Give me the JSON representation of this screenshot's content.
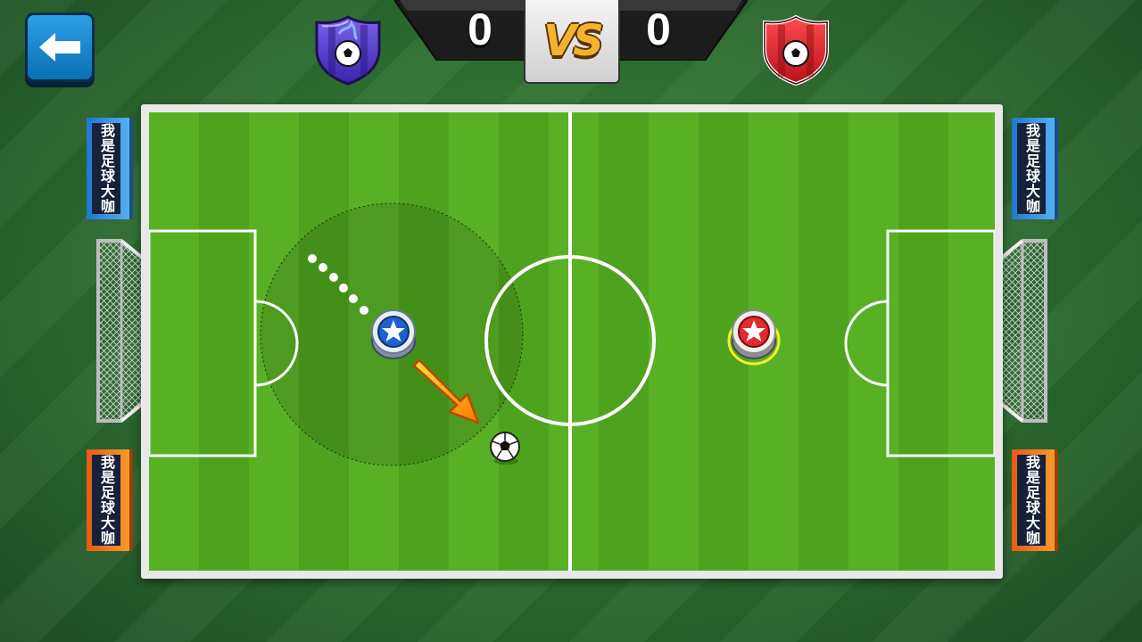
{
  "header": {
    "back_button": {
      "icon": "back-arrow-icon"
    },
    "score": {
      "left": "0",
      "right": "0",
      "vs_label": "VS"
    },
    "teams": {
      "left": {
        "icon": "soccer-ball-shield-icon",
        "color": "#5b3fd6"
      },
      "right": {
        "icon": "soccer-ball-shield-icon",
        "color": "#e2232a"
      }
    }
  },
  "banners": {
    "text": "我是足球大咖",
    "colors": {
      "blue": "#2b8fe0",
      "orange": "#ef7a1f"
    }
  },
  "field": {
    "colors": {
      "grass_light": "#58b125",
      "grass_dark": "#4ea31e",
      "line": "#ffffff"
    },
    "player_left": {
      "team": "blue",
      "icon": "star-icon"
    },
    "player_right": {
      "team": "red",
      "icon": "star-icon",
      "selected": true
    },
    "ball": {
      "icon": "soccer-ball-icon"
    }
  }
}
